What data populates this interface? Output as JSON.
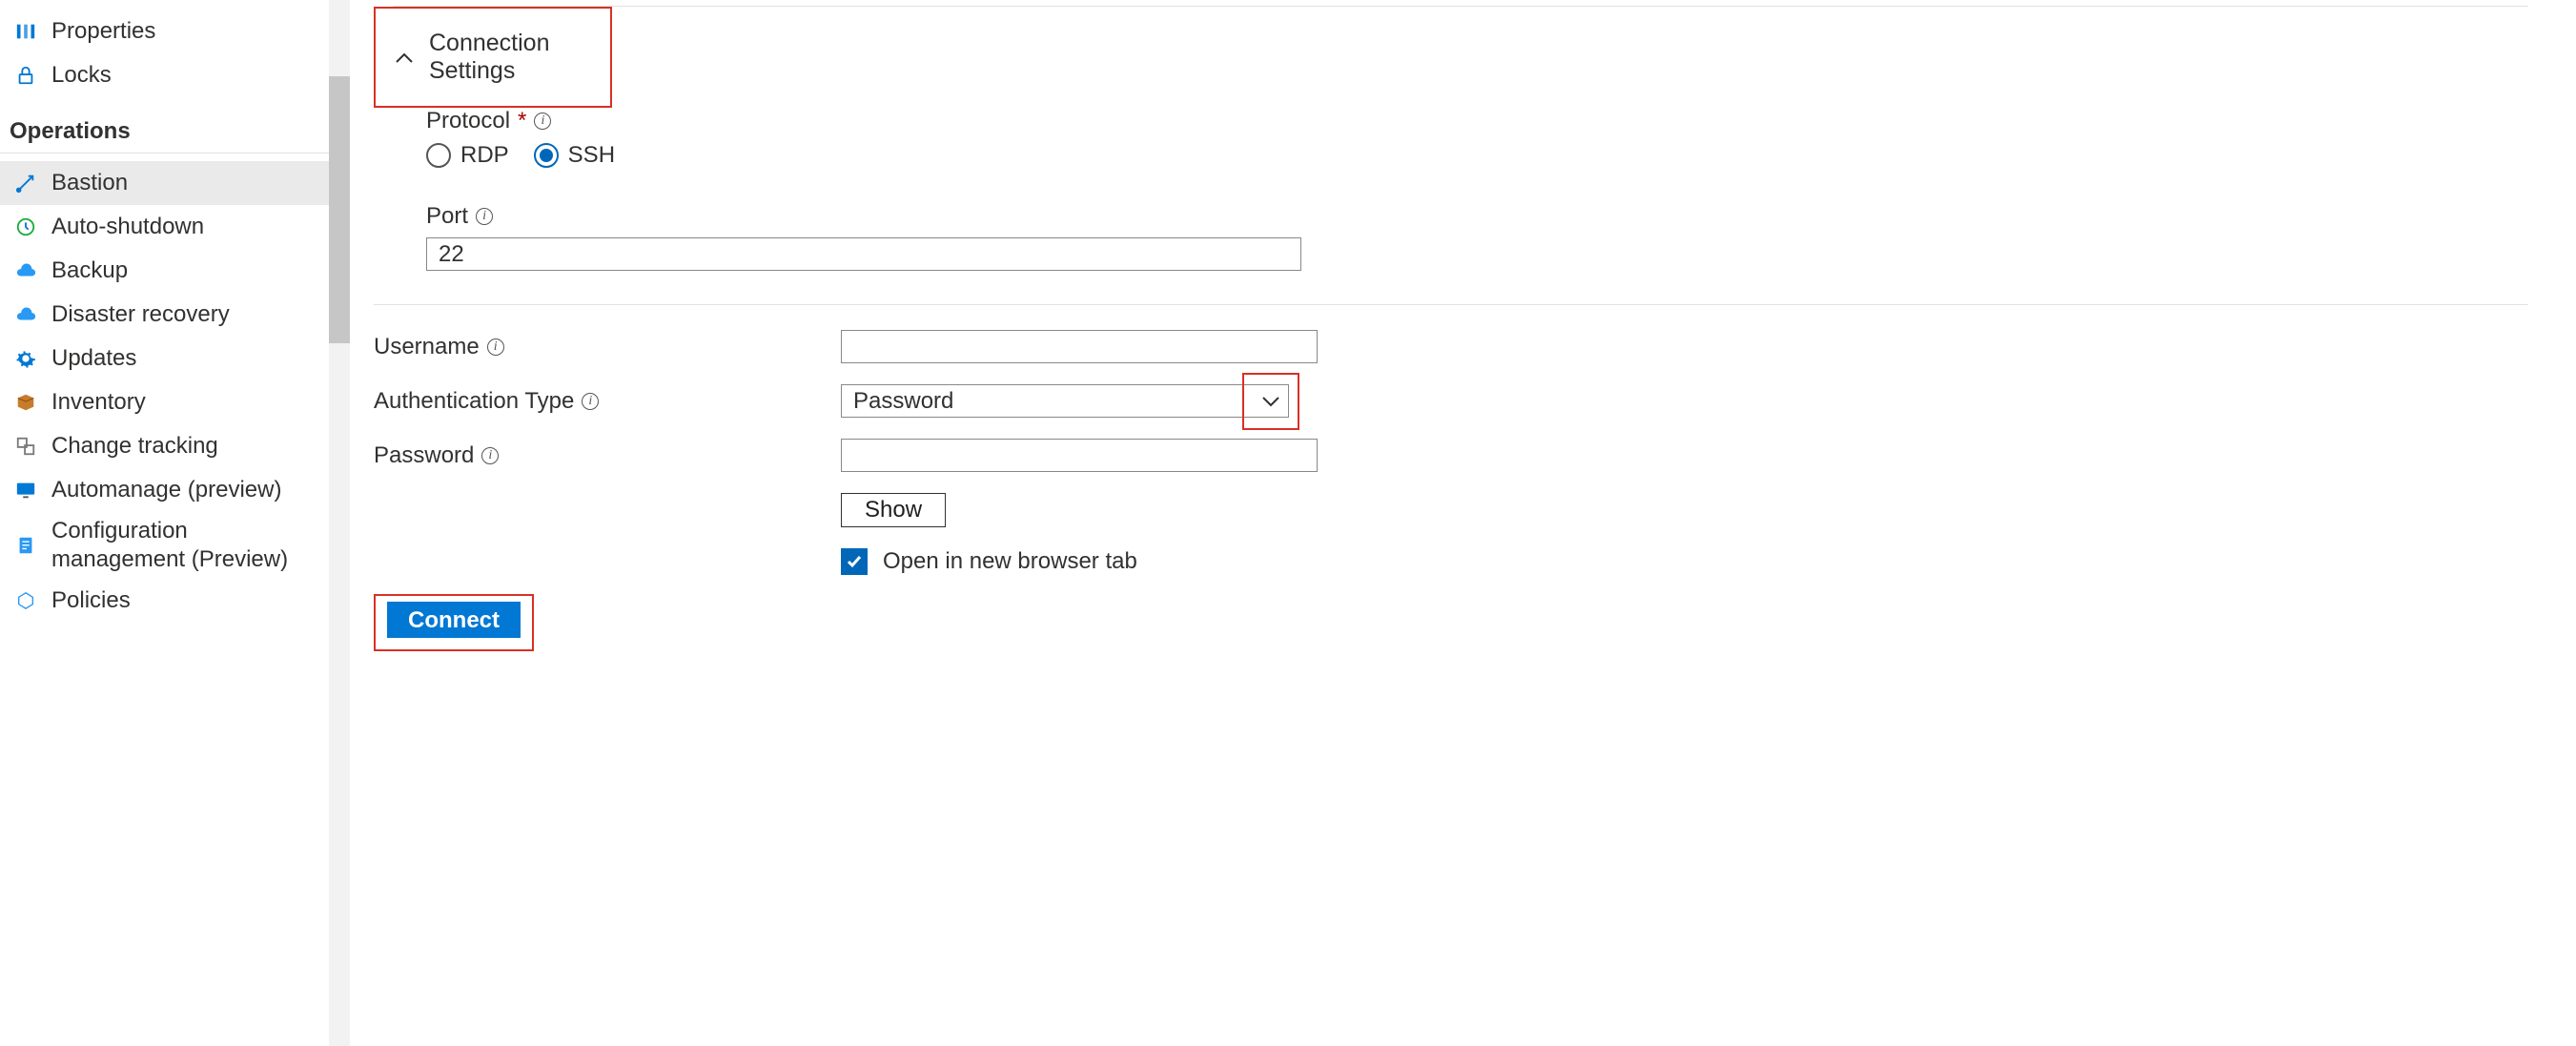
{
  "sidebar": {
    "items_top": [
      {
        "label": "Properties",
        "icon": "properties"
      },
      {
        "label": "Locks",
        "icon": "lock"
      }
    ],
    "section_label": "Operations",
    "items_ops": [
      {
        "label": "Bastion",
        "icon": "bastion",
        "active": true
      },
      {
        "label": "Auto-shutdown",
        "icon": "clock"
      },
      {
        "label": "Backup",
        "icon": "cloud"
      },
      {
        "label": "Disaster recovery",
        "icon": "cloud"
      },
      {
        "label": "Updates",
        "icon": "gear"
      },
      {
        "label": "Inventory",
        "icon": "box"
      },
      {
        "label": "Change tracking",
        "icon": "track"
      },
      {
        "label": "Automanage (preview)",
        "icon": "monitor"
      },
      {
        "label": "Configuration management (Preview)",
        "icon": "doc"
      },
      {
        "label": "Policies",
        "icon": "policy"
      }
    ]
  },
  "main": {
    "section_title": "Connection Settings",
    "protocol": {
      "label": "Protocol",
      "options": [
        "RDP",
        "SSH"
      ],
      "selected": "SSH"
    },
    "port": {
      "label": "Port",
      "value": "22"
    },
    "username": {
      "label": "Username",
      "value": ""
    },
    "auth_type": {
      "label": "Authentication Type",
      "value": "Password"
    },
    "password": {
      "label": "Password",
      "value": ""
    },
    "show_label": "Show",
    "new_tab_label": "Open in new browser tab",
    "new_tab_checked": true,
    "connect_label": "Connect"
  }
}
